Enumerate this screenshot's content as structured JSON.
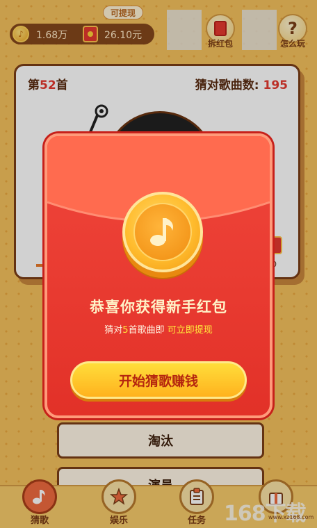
{
  "top": {
    "withdraw_tag": "可提现",
    "coins": "1.68万",
    "cash": "26.10元",
    "split_rp_label": "拆红包",
    "how_to_play_label": "怎么玩"
  },
  "card": {
    "song_prefix": "第",
    "song_number": "52",
    "song_suffix": "首",
    "guessed_label": "猜对歌曲数:",
    "guessed_value": "195",
    "side_value": "30"
  },
  "options": [
    "淘汰",
    "演员"
  ],
  "modal": {
    "headline": "恭喜你获得新手红包",
    "sub_prefix": "猜对",
    "sub_count": "5",
    "sub_middle": "首歌曲即",
    "sub_highlight": "可立即提现",
    "button": "开始猜歌赚钱"
  },
  "nav": {
    "items": [
      {
        "label": "猜歌",
        "icon": "music-note-icon",
        "active": true
      },
      {
        "label": "娱乐",
        "icon": "star-icon",
        "active": false
      },
      {
        "label": "任务",
        "icon": "clipboard-icon",
        "active": false
      },
      {
        "label": "",
        "icon": "gift-icon",
        "active": false
      }
    ]
  },
  "watermark": {
    "brand": "168下载",
    "url": "www.xz168.com"
  },
  "colors": {
    "envelope_red": "#e23128",
    "button_yellow": "#ffc229",
    "brand_brown": "#7a3d17"
  }
}
